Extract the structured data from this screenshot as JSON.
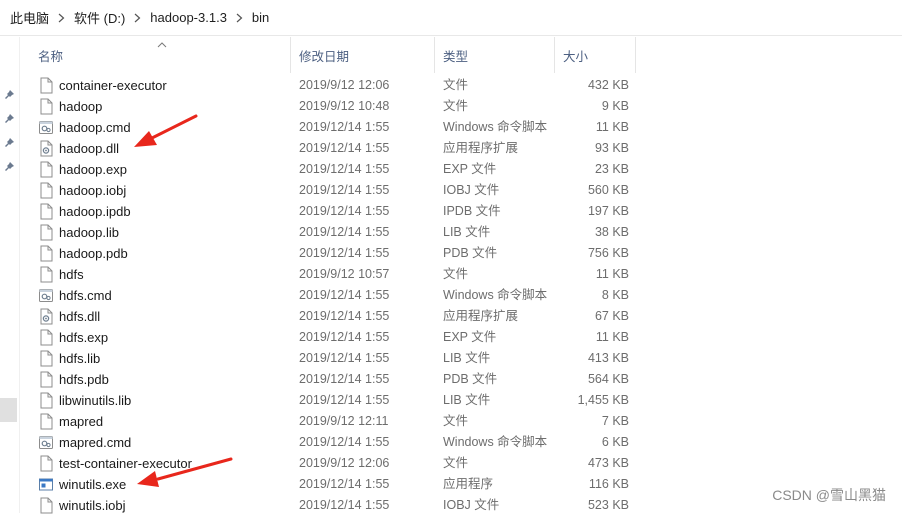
{
  "breadcrumb": {
    "items": [
      "此电脑",
      "软件 (D:)",
      "hadoop-3.1.3",
      "bin"
    ]
  },
  "columns": {
    "name": "名称",
    "date": "修改日期",
    "type": "类型",
    "size": "大小"
  },
  "files": [
    {
      "name": "container-executor",
      "date": "2019/9/12 12:06",
      "type": "文件",
      "size": "432 KB",
      "icon": "file-icon"
    },
    {
      "name": "hadoop",
      "date": "2019/9/12 10:48",
      "type": "文件",
      "size": "9 KB",
      "icon": "file-icon"
    },
    {
      "name": "hadoop.cmd",
      "date": "2019/12/14 1:55",
      "type": "Windows 命令脚本",
      "size": "11 KB",
      "icon": "cmd-script-icon"
    },
    {
      "name": "hadoop.dll",
      "date": "2019/12/14 1:55",
      "type": "应用程序扩展",
      "size": "93 KB",
      "icon": "dll-icon"
    },
    {
      "name": "hadoop.exp",
      "date": "2019/12/14 1:55",
      "type": "EXP 文件",
      "size": "23 KB",
      "icon": "file-icon"
    },
    {
      "name": "hadoop.iobj",
      "date": "2019/12/14 1:55",
      "type": "IOBJ 文件",
      "size": "560 KB",
      "icon": "file-icon"
    },
    {
      "name": "hadoop.ipdb",
      "date": "2019/12/14 1:55",
      "type": "IPDB 文件",
      "size": "197 KB",
      "icon": "file-icon"
    },
    {
      "name": "hadoop.lib",
      "date": "2019/12/14 1:55",
      "type": "LIB 文件",
      "size": "38 KB",
      "icon": "file-icon"
    },
    {
      "name": "hadoop.pdb",
      "date": "2019/12/14 1:55",
      "type": "PDB 文件",
      "size": "756 KB",
      "icon": "file-icon"
    },
    {
      "name": "hdfs",
      "date": "2019/9/12 10:57",
      "type": "文件",
      "size": "11 KB",
      "icon": "file-icon"
    },
    {
      "name": "hdfs.cmd",
      "date": "2019/12/14 1:55",
      "type": "Windows 命令脚本",
      "size": "8 KB",
      "icon": "cmd-script-icon"
    },
    {
      "name": "hdfs.dll",
      "date": "2019/12/14 1:55",
      "type": "应用程序扩展",
      "size": "67 KB",
      "icon": "dll-icon"
    },
    {
      "name": "hdfs.exp",
      "date": "2019/12/14 1:55",
      "type": "EXP 文件",
      "size": "11 KB",
      "icon": "file-icon"
    },
    {
      "name": "hdfs.lib",
      "date": "2019/12/14 1:55",
      "type": "LIB 文件",
      "size": "413 KB",
      "icon": "file-icon"
    },
    {
      "name": "hdfs.pdb",
      "date": "2019/12/14 1:55",
      "type": "PDB 文件",
      "size": "564 KB",
      "icon": "file-icon"
    },
    {
      "name": "libwinutils.lib",
      "date": "2019/12/14 1:55",
      "type": "LIB 文件",
      "size": "1,455 KB",
      "icon": "file-icon"
    },
    {
      "name": "mapred",
      "date": "2019/9/12 12:11",
      "type": "文件",
      "size": "7 KB",
      "icon": "file-icon"
    },
    {
      "name": "mapred.cmd",
      "date": "2019/12/14 1:55",
      "type": "Windows 命令脚本",
      "size": "6 KB",
      "icon": "cmd-script-icon"
    },
    {
      "name": "test-container-executor",
      "date": "2019/9/12 12:06",
      "type": "文件",
      "size": "473 KB",
      "icon": "file-icon"
    },
    {
      "name": "winutils.exe",
      "date": "2019/12/14 1:55",
      "type": "应用程序",
      "size": "116 KB",
      "icon": "exe-icon"
    },
    {
      "name": "winutils.iobj",
      "date": "2019/12/14 1:55",
      "type": "IOBJ 文件",
      "size": "523 KB",
      "icon": "file-icon"
    }
  ],
  "watermark": "CSDN @雪山黑猫",
  "colors": {
    "annotation_arrow": "#e8271c",
    "header_text": "#4d6082"
  }
}
